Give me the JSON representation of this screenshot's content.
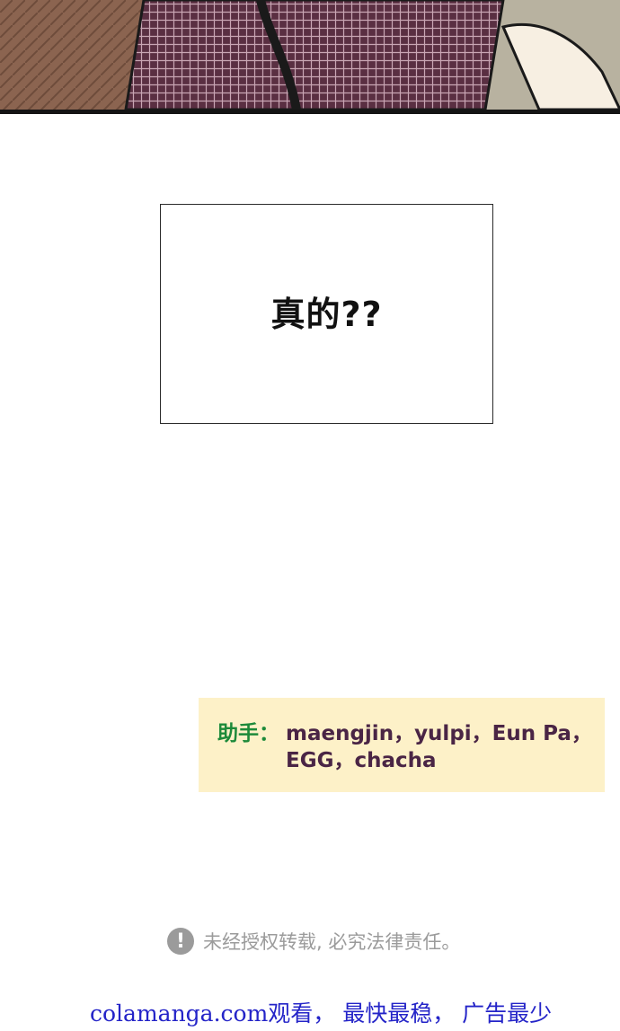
{
  "panel": {
    "colors": {
      "background": "#8a6a57",
      "shirt": "#5a2f42",
      "wall": "#b8b2a0",
      "border": "#141414"
    }
  },
  "dialogue": {
    "text": "真的??"
  },
  "credits": {
    "label": "助手：",
    "line1": "maengjin，yulpi，Eun Pa，",
    "line2": "EGG，chacha",
    "colors": {
      "background": "#fdf1c8",
      "label": "#1d8a3a",
      "names": "#4a2545"
    }
  },
  "notice": {
    "icon": "exclamation-circle-icon",
    "icon_glyph": "!",
    "text": "未经授权转载, 必究法律责任。"
  },
  "watermark": {
    "text": "colamanga.com观看， 最快最稳， 广告最少"
  }
}
